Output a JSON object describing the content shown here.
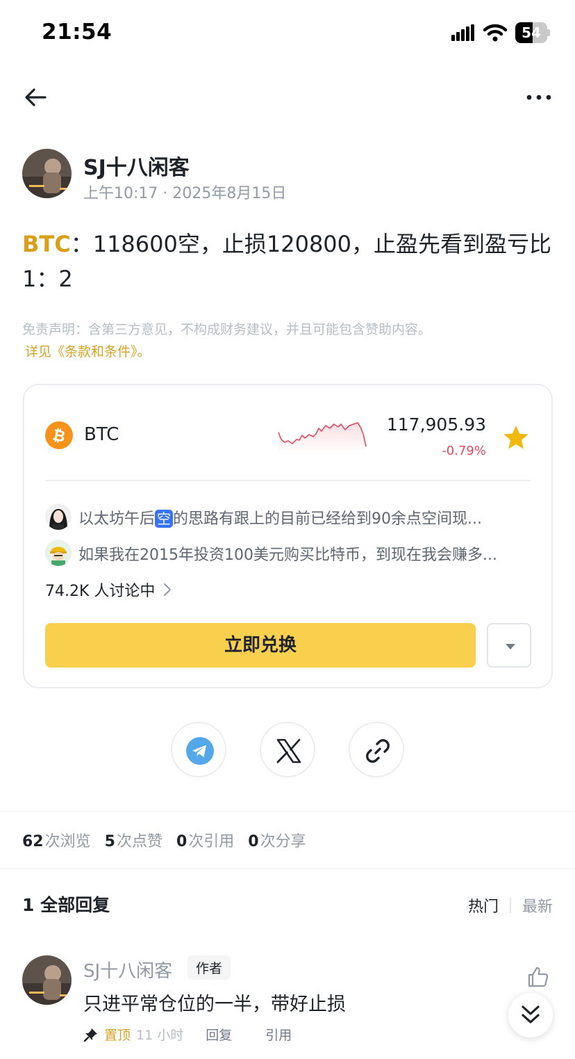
{
  "status_bar": {
    "time": "21:54",
    "battery": "54",
    "battery_level": 0.54
  },
  "post": {
    "author_name": "SJ十八闲客",
    "time": "上午10:17",
    "date": "2025年8月15日",
    "cashtag": "BTC",
    "body": "：118600空，止损120800，止盈先看到盈亏比1：2",
    "disclaimer": "免责声明：含第三方意见，不构成财务建议，并且可能包含赞助内容。",
    "disclaimer_link": "详见《条款和条件》。"
  },
  "coin_card": {
    "symbol": "BTC",
    "price": "117,905.93",
    "change": "-0.79%",
    "accent": "#f7931a",
    "change_color": "#e04a5f",
    "comment_1_before": "以太坊午后",
    "comment_1_tag": "空",
    "comment_1_after": "的思路有跟上的目前已经给到90余点空间现...",
    "comment_2": "如果我在2015年投资100美元购买比特币，到现在我会赚多...",
    "discussing": "74.2K 人讨论中",
    "convert_label": "立即兑换"
  },
  "stats": {
    "views_count": "62",
    "views_label": "次浏览",
    "likes_count": "5",
    "likes_label": "次点赞",
    "quotes_count": "0",
    "quotes_label": "次引用",
    "shares_count": "0",
    "shares_label": "次分享"
  },
  "replies": {
    "title": "1 全部回复",
    "sort_hot": "热门",
    "sort_new": "最新",
    "items": [
      {
        "name": "SJ十八闲客",
        "badge": "作者",
        "text": "只进平常仓位的一半，带好止损",
        "pinned": "置顶",
        "time": "11 小时",
        "reply": "回复",
        "quote": "引用"
      }
    ]
  }
}
